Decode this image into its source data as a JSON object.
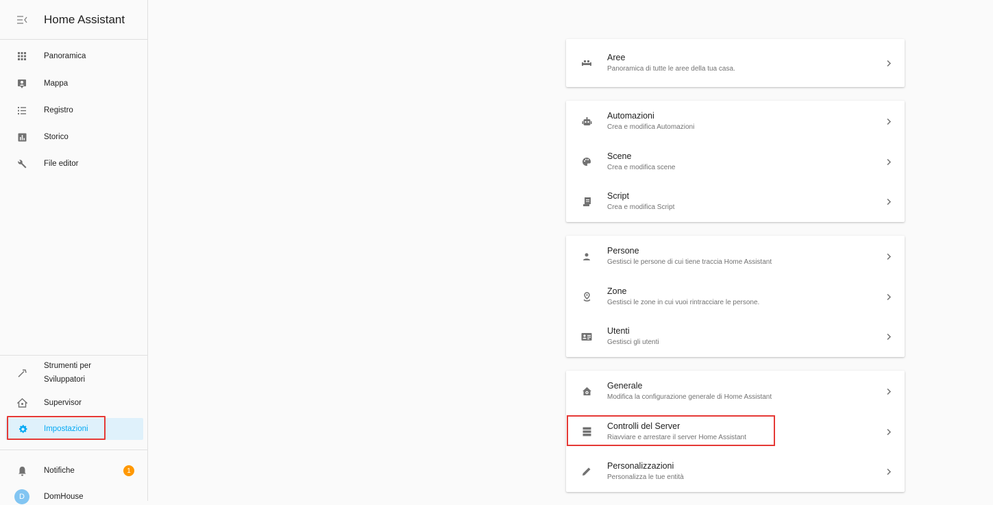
{
  "app": {
    "title": "Home Assistant"
  },
  "sidebar": {
    "items": [
      {
        "label": "Panoramica",
        "icon": "apps-grid-icon"
      },
      {
        "label": "Mappa",
        "icon": "map-account-icon"
      },
      {
        "label": "Registro",
        "icon": "format-list-icon"
      },
      {
        "label": "Storico",
        "icon": "chart-box-icon"
      },
      {
        "label": "File editor",
        "icon": "wrench-icon"
      }
    ],
    "bottom_items": [
      {
        "label_line1": "Strumenti per",
        "label_line2": "Sviluppatori",
        "icon": "hammer-icon"
      },
      {
        "label": "Supervisor",
        "icon": "home-assistant-icon"
      },
      {
        "label": "Impostazioni",
        "icon": "gear-icon",
        "active": true
      }
    ],
    "notifications": {
      "label": "Notifiche",
      "count": "1",
      "icon": "bell-icon"
    },
    "user": {
      "name": "DomHouse",
      "initial": "D"
    }
  },
  "config": {
    "groups": [
      {
        "rows": [
          {
            "title": "Aree",
            "subtitle": "Panoramica di tutte le aree della tua casa.",
            "icon": "sofa-icon"
          }
        ]
      },
      {
        "rows": [
          {
            "title": "Automazioni",
            "subtitle": "Crea e modifica Automazioni",
            "icon": "robot-icon"
          },
          {
            "title": "Scene",
            "subtitle": "Crea e modifica scene",
            "icon": "palette-icon"
          },
          {
            "title": "Script",
            "subtitle": "Crea e modifica Script",
            "icon": "script-icon"
          }
        ]
      },
      {
        "rows": [
          {
            "title": "Persone",
            "subtitle": "Gestisci le persone di cui tiene traccia Home Assistant",
            "icon": "account-icon"
          },
          {
            "title": "Zone",
            "subtitle": "Gestisci le zone in cui vuoi rintracciare le persone.",
            "icon": "map-marker-radius-icon"
          },
          {
            "title": "Utenti",
            "subtitle": "Gestisci gli utenti",
            "icon": "account-badge-icon"
          }
        ]
      },
      {
        "rows": [
          {
            "title": "Generale",
            "subtitle": "Modifica la configurazione generale di Home Assistant",
            "icon": "home-gear-icon"
          },
          {
            "title": "Controlli del Server",
            "subtitle": "Riavviare e arrestare il server Home Assistant",
            "icon": "server-icon"
          },
          {
            "title": "Personalizzazioni",
            "subtitle": "Personalizza le tue entità",
            "icon": "pencil-icon"
          }
        ]
      }
    ]
  },
  "colors": {
    "accent": "#03a9f4",
    "active_bg": "#dff1fb",
    "highlight": "#e53935",
    "badge": "#ff9800",
    "icon": "#727272"
  }
}
